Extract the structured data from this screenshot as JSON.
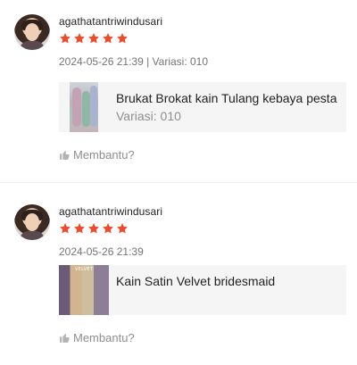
{
  "colors": {
    "star": "#ee4d2d",
    "muted": "#757575",
    "card_bg": "#f5f5f5"
  },
  "reviews": [
    {
      "username": "agathatantriwindusari",
      "rating": 5,
      "meta": "2024-05-26 21:39 | Variasi: 010",
      "product_title": "Brukat Brokat kain Tulang kebaya pesta",
      "product_variant": "Variasi: 010",
      "helpful_label": "Membantu?",
      "icons": {
        "avatar": "user-avatar",
        "star": "star-icon",
        "thumb": "thumbs-up-icon"
      }
    },
    {
      "username": "agathatantriwindusari",
      "rating": 5,
      "meta": "2024-05-26 21:39",
      "product_title": "Kain Satin Velvet bridesmaid",
      "thumb_label": "VELVET",
      "helpful_label": "Membantu?",
      "icons": {
        "avatar": "user-avatar",
        "star": "star-icon",
        "thumb": "thumbs-up-icon"
      }
    }
  ]
}
